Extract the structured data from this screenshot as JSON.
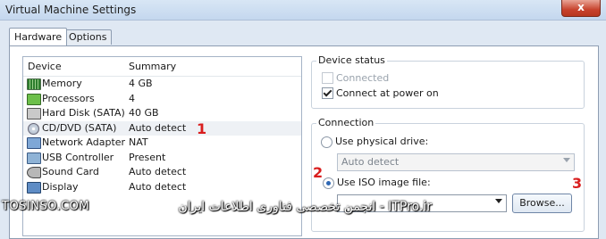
{
  "window": {
    "title": "Virtual Machine Settings",
    "close_glyph": "x"
  },
  "tabs": [
    {
      "label": "Hardware"
    },
    {
      "label": "Options"
    }
  ],
  "device_list": {
    "headers": {
      "device": "Device",
      "summary": "Summary"
    },
    "rows": [
      {
        "icon": "memory-icon",
        "device": "Memory",
        "summary": "4 GB"
      },
      {
        "icon": "processor-icon",
        "device": "Processors",
        "summary": "4"
      },
      {
        "icon": "hard-disk-icon",
        "device": "Hard Disk (SATA)",
        "summary": "40 GB"
      },
      {
        "icon": "cd-dvd-icon",
        "device": "CD/DVD (SATA)",
        "summary": "Auto detect"
      },
      {
        "icon": "network-adapter-icon",
        "device": "Network Adapter",
        "summary": "NAT"
      },
      {
        "icon": "usb-controller-icon",
        "device": "USB Controller",
        "summary": "Present"
      },
      {
        "icon": "sound-card-icon",
        "device": "Sound Card",
        "summary": "Auto detect"
      },
      {
        "icon": "display-icon",
        "device": "Display",
        "summary": "Auto detect"
      }
    ]
  },
  "annotations": {
    "one": "1",
    "two": "2",
    "three": "3"
  },
  "device_status": {
    "title": "Device status",
    "connected": {
      "label": "Connected",
      "checked": false,
      "disabled": true
    },
    "connect_power_on": {
      "label": "Connect at power on",
      "checked": true
    }
  },
  "connection": {
    "title": "Connection",
    "physical": {
      "label": "Use physical drive:",
      "selected": false
    },
    "physical_value": "Auto detect",
    "iso": {
      "label": "Use ISO image file:",
      "selected": true
    },
    "iso_value": "",
    "browse_label": "Browse..."
  },
  "watermark": {
    "left": "TOSINSO.COM",
    "right": "ITPro.ir - انجمن تخصصی فناوری اطلاعات ایران"
  }
}
